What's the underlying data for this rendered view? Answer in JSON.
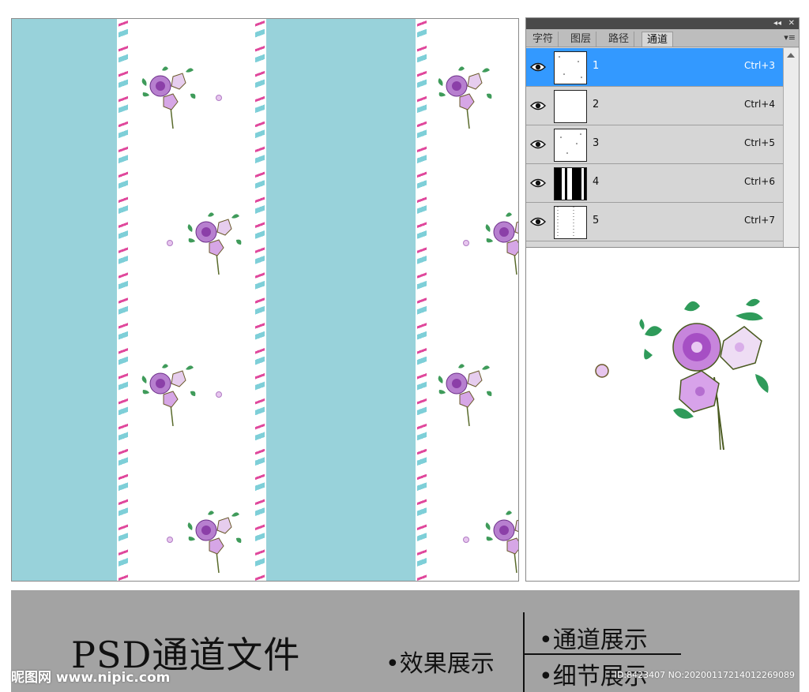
{
  "panel": {
    "collapse_icon": "double-arrow-left-icon",
    "close_icon": "close-icon",
    "menu_icon": "panel-menu-icon",
    "tabs": [
      {
        "label": "字符"
      },
      {
        "label": "图层"
      },
      {
        "label": "路径"
      },
      {
        "label": "通道"
      }
    ],
    "active_tab": "通道",
    "channels": [
      {
        "name": "1",
        "shortcut": "Ctrl+3",
        "selected": true,
        "visible": true
      },
      {
        "name": "2",
        "shortcut": "Ctrl+4",
        "selected": false,
        "visible": true
      },
      {
        "name": "3",
        "shortcut": "Ctrl+5",
        "selected": false,
        "visible": true
      },
      {
        "name": "4",
        "shortcut": "Ctrl+6",
        "selected": false,
        "visible": true
      },
      {
        "name": "5",
        "shortcut": "Ctrl+7",
        "selected": false,
        "visible": true
      }
    ],
    "selection_color": "#3399ff"
  },
  "pattern": {
    "band_color": "#98d2da",
    "stripe_colors": [
      "#e0489c",
      "#7ecfd8"
    ],
    "flower_colors": [
      "#c79ad6",
      "#8b3fa8",
      "#3f9b5a"
    ]
  },
  "banner": {
    "title": "PSD通道文件",
    "items": [
      {
        "label": "•效果展示"
      },
      {
        "label": "•通道展示"
      },
      {
        "label": "•细节展示"
      }
    ],
    "watermark_logo": "昵图网 www.nipic.com",
    "watermark_id": "ID:8423407 NO:20200117214012269089"
  }
}
